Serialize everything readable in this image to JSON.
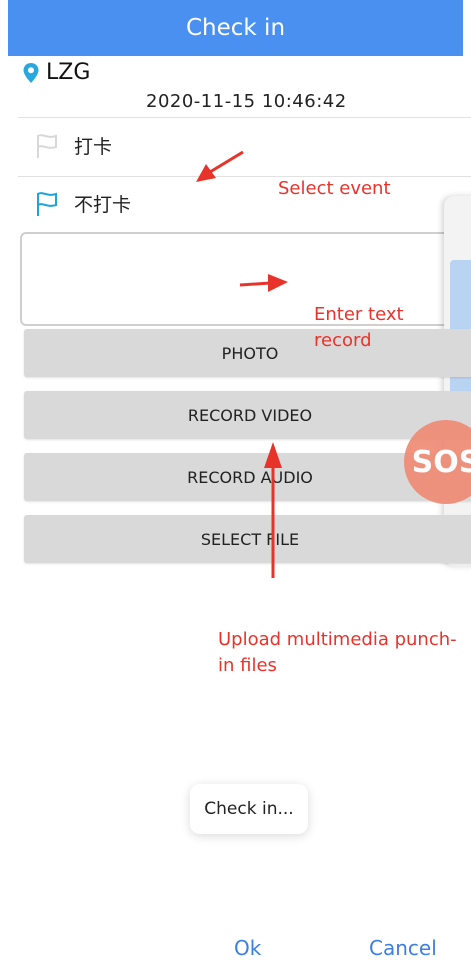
{
  "title": "Check in",
  "location": {
    "icon": "location-pin-icon",
    "text": "LZG"
  },
  "datetime": "2020-11-15 10:46:42",
  "events": [
    {
      "label": "打卡",
      "icon": "flag-icon",
      "selected": false
    },
    {
      "label": "不打卡",
      "icon": "flag-icon",
      "selected": true
    }
  ],
  "text_record": {
    "value": "",
    "placeholder": ""
  },
  "buttons": {
    "photo": "PHOTO",
    "record_video": "RECORD VIDEO",
    "record_audio": "RECORD AUDIO",
    "select_file": "SELECT FILE"
  },
  "sos_label": "SOS",
  "toast": "Check in...",
  "dialog": {
    "ok": "Ok",
    "cancel": "Cancel"
  },
  "annotations": {
    "select_event": "Select event",
    "enter_text_1": "Enter text",
    "enter_text_2": "record",
    "upload_1": "Upload multimedia punch-",
    "upload_2": "in files"
  },
  "colors": {
    "accent": "#4a90f0",
    "annotation": "#e8332a",
    "dialog_button": "#3b7fe0",
    "sos": "#ef8a75"
  }
}
